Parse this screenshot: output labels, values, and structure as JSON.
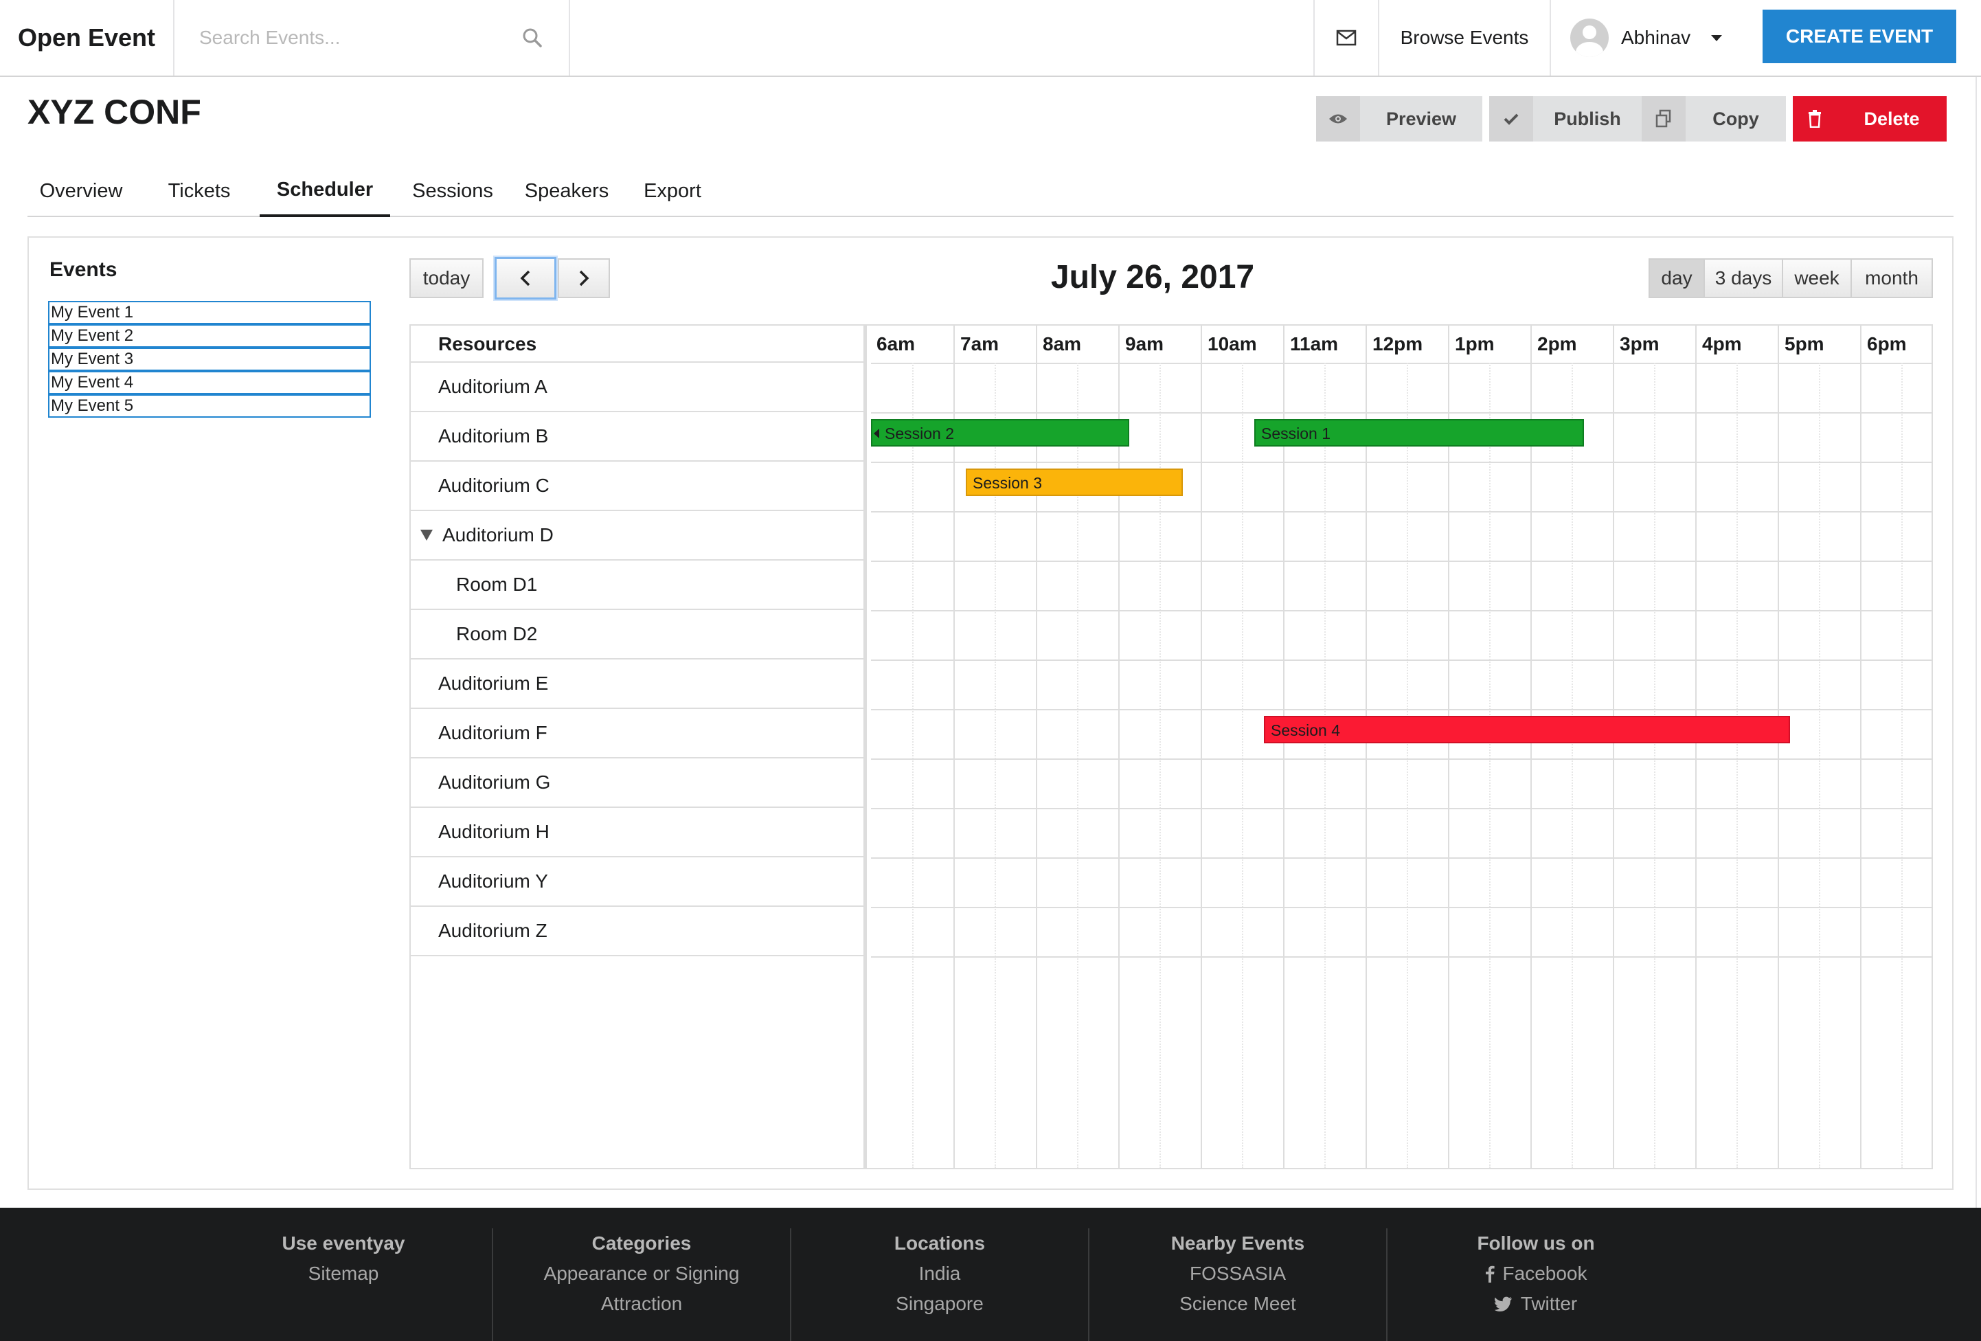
{
  "navbar": {
    "brand": "Open Event",
    "search_placeholder": "Search Events...",
    "browse_label": "Browse Events",
    "user_name": "Abhinav",
    "create_label": "CREATE EVENT"
  },
  "header": {
    "title": "XYZ CONF",
    "actions": {
      "preview": "Preview",
      "publish": "Publish",
      "copy": "Copy",
      "delete": "Delete"
    }
  },
  "tabs": [
    "Overview",
    "Tickets",
    "Scheduler",
    "Sessions",
    "Speakers",
    "Export"
  ],
  "active_tab": "Scheduler",
  "events_panel": {
    "title": "Events",
    "items": [
      "My Event 1",
      "My Event 2",
      "My Event 3",
      "My Event 4",
      "My Event 5"
    ]
  },
  "calendar": {
    "today_label": "today",
    "title": "July 26, 2017",
    "views": [
      "day",
      "3 days",
      "week",
      "month"
    ],
    "active_view": "day",
    "resources_header": "Resources",
    "hours": [
      "6am",
      "7am",
      "8am",
      "9am",
      "10am",
      "11am",
      "12pm",
      "1pm",
      "2pm",
      "3pm",
      "4pm",
      "5pm",
      "6pm"
    ],
    "resources": [
      {
        "name": "Auditorium A",
        "level": 0
      },
      {
        "name": "Auditorium B",
        "level": 0
      },
      {
        "name": "Auditorium C",
        "level": 0
      },
      {
        "name": "Auditorium D",
        "level": 0,
        "expanded": true
      },
      {
        "name": "Room D1",
        "level": 1
      },
      {
        "name": "Room D2",
        "level": 1
      },
      {
        "name": "Auditorium E",
        "level": 0
      },
      {
        "name": "Auditorium F",
        "level": 0
      },
      {
        "name": "Auditorium G",
        "level": 0
      },
      {
        "name": "Auditorium H",
        "level": 0
      },
      {
        "name": "Auditorium Y",
        "level": 0
      },
      {
        "name": "Auditorium Z",
        "level": 0
      }
    ],
    "sessions": [
      {
        "title": "Session 2",
        "resource_index": 1,
        "color": "#16a42b"
      },
      {
        "title": "Session 1",
        "resource_index": 1,
        "color": "#16a42b"
      },
      {
        "title": "Session 3",
        "resource_index": 2,
        "color": "#fbb40a"
      },
      {
        "title": "Session 4",
        "resource_index": 7,
        "color": "#fb1a33"
      }
    ]
  },
  "footer": {
    "columns": [
      {
        "heading": "Use eventyay",
        "links": [
          "Sitemap"
        ]
      },
      {
        "heading": "Categories",
        "links": [
          "Appearance or Signing",
          "Attraction"
        ]
      },
      {
        "heading": "Locations",
        "links": [
          "India",
          "Singapore"
        ]
      },
      {
        "heading": "Nearby Events",
        "links": [
          "FOSSASIA",
          "Science Meet"
        ]
      },
      {
        "heading": "Follow us on",
        "links": [
          "Facebook",
          "Twitter"
        ]
      }
    ]
  },
  "colors": {
    "primary": "#2185d0",
    "danger": "#e3142a",
    "footer_bg": "#1b1c1d"
  }
}
